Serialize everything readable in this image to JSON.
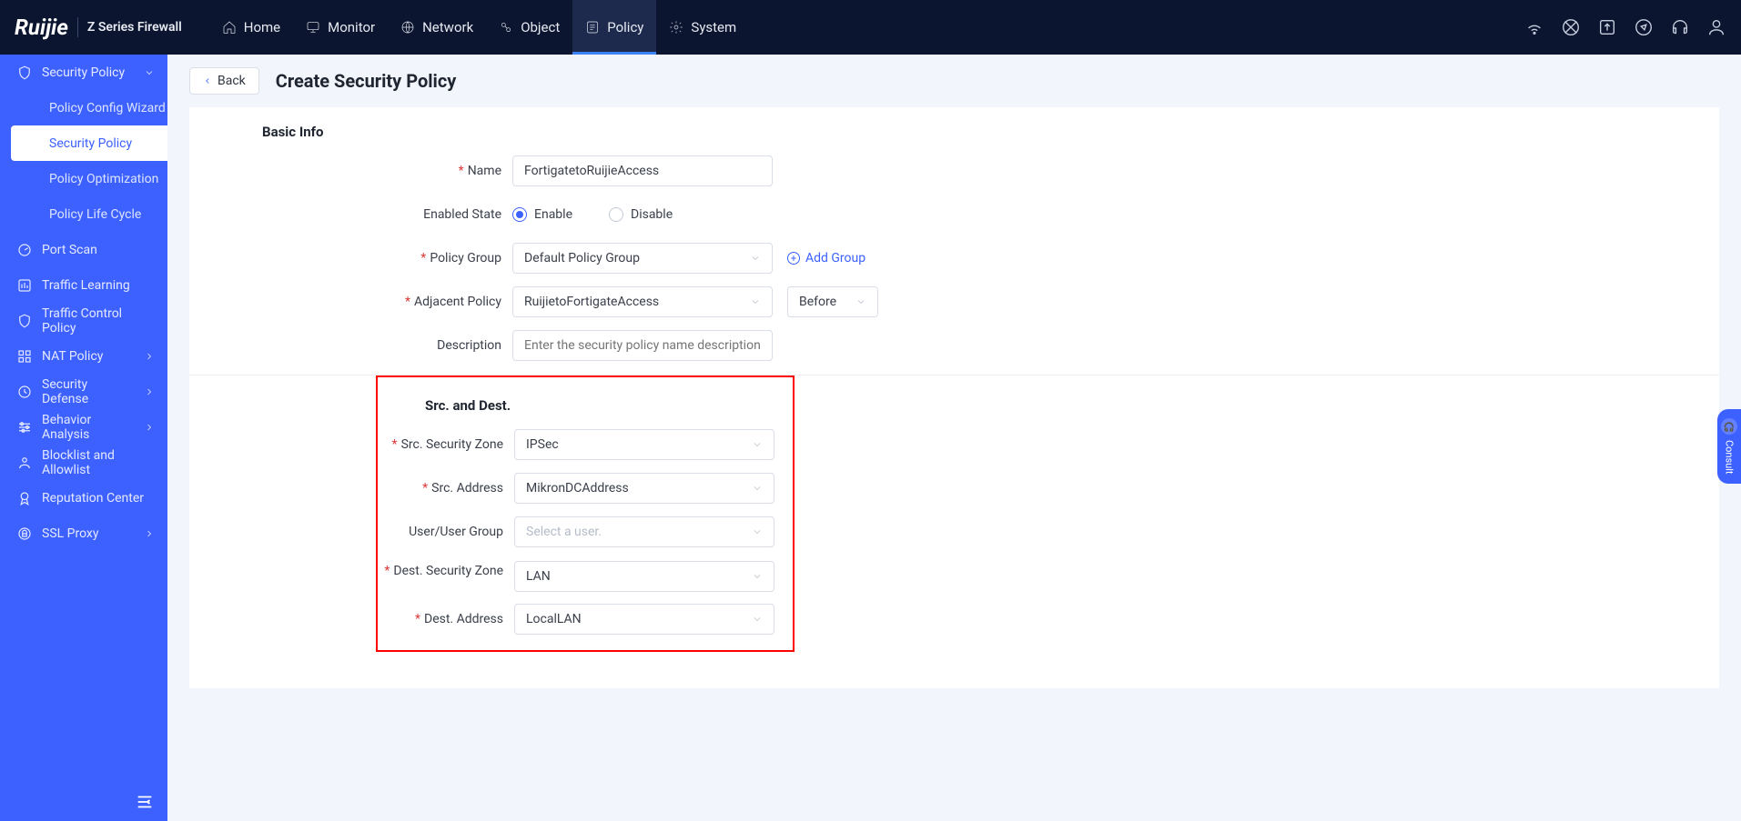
{
  "brand": {
    "logo": "Ruijie",
    "product": "Z Series Firewall"
  },
  "topnav": {
    "items": [
      {
        "label": "Home",
        "active": false
      },
      {
        "label": "Monitor",
        "active": false
      },
      {
        "label": "Network",
        "active": false
      },
      {
        "label": "Object",
        "active": false
      },
      {
        "label": "Policy",
        "active": true
      },
      {
        "label": "System",
        "active": false
      }
    ]
  },
  "sidebar": {
    "security_policy": "Security Policy",
    "subs": [
      {
        "label": "Policy Config Wizard",
        "active": false
      },
      {
        "label": "Security Policy",
        "active": true
      },
      {
        "label": "Policy Optimization",
        "active": false
      },
      {
        "label": "Policy Life Cycle",
        "active": false
      }
    ],
    "items": [
      {
        "label": "Port Scan"
      },
      {
        "label": "Traffic Learning"
      },
      {
        "label": "Traffic Control Policy"
      },
      {
        "label": "NAT Policy",
        "chev": true
      },
      {
        "label": "Security Defense",
        "chev": true
      },
      {
        "label": "Behavior Analysis",
        "chev": true
      },
      {
        "label": "Blocklist and Allowlist"
      },
      {
        "label": "Reputation Center"
      },
      {
        "label": "SSL Proxy",
        "chev": true
      }
    ]
  },
  "page": {
    "back": "Back",
    "title": "Create Security Policy"
  },
  "form": {
    "basic_info_title": "Basic Info",
    "name_label": "Name",
    "name_value": "FortigatetoRuijieAccess",
    "enabled_state_label": "Enabled State",
    "enable": "Enable",
    "disable": "Disable",
    "policy_group_label": "Policy Group",
    "policy_group_value": "Default Policy Group",
    "add_group": "Add Group",
    "adjacent_policy_label": "Adjacent Policy",
    "adjacent_policy_value": "RuijietoFortigateAccess",
    "position_value": "Before",
    "description_label": "Description",
    "description_placeholder": "Enter the security policy name description",
    "src_dest_title": "Src. and Dest.",
    "src_zone_label": "Src. Security Zone",
    "src_zone_value": "IPSec",
    "src_addr_label": "Src. Address",
    "src_addr_value": "MikronDCAddress",
    "user_group_label": "User/User Group",
    "user_group_placeholder": "Select a user.",
    "dest_zone_label": "Dest. Security Zone",
    "dest_zone_value": "LAN",
    "dest_addr_label": "Dest. Address",
    "dest_addr_value": "LocalLAN"
  },
  "consult": "Consult"
}
